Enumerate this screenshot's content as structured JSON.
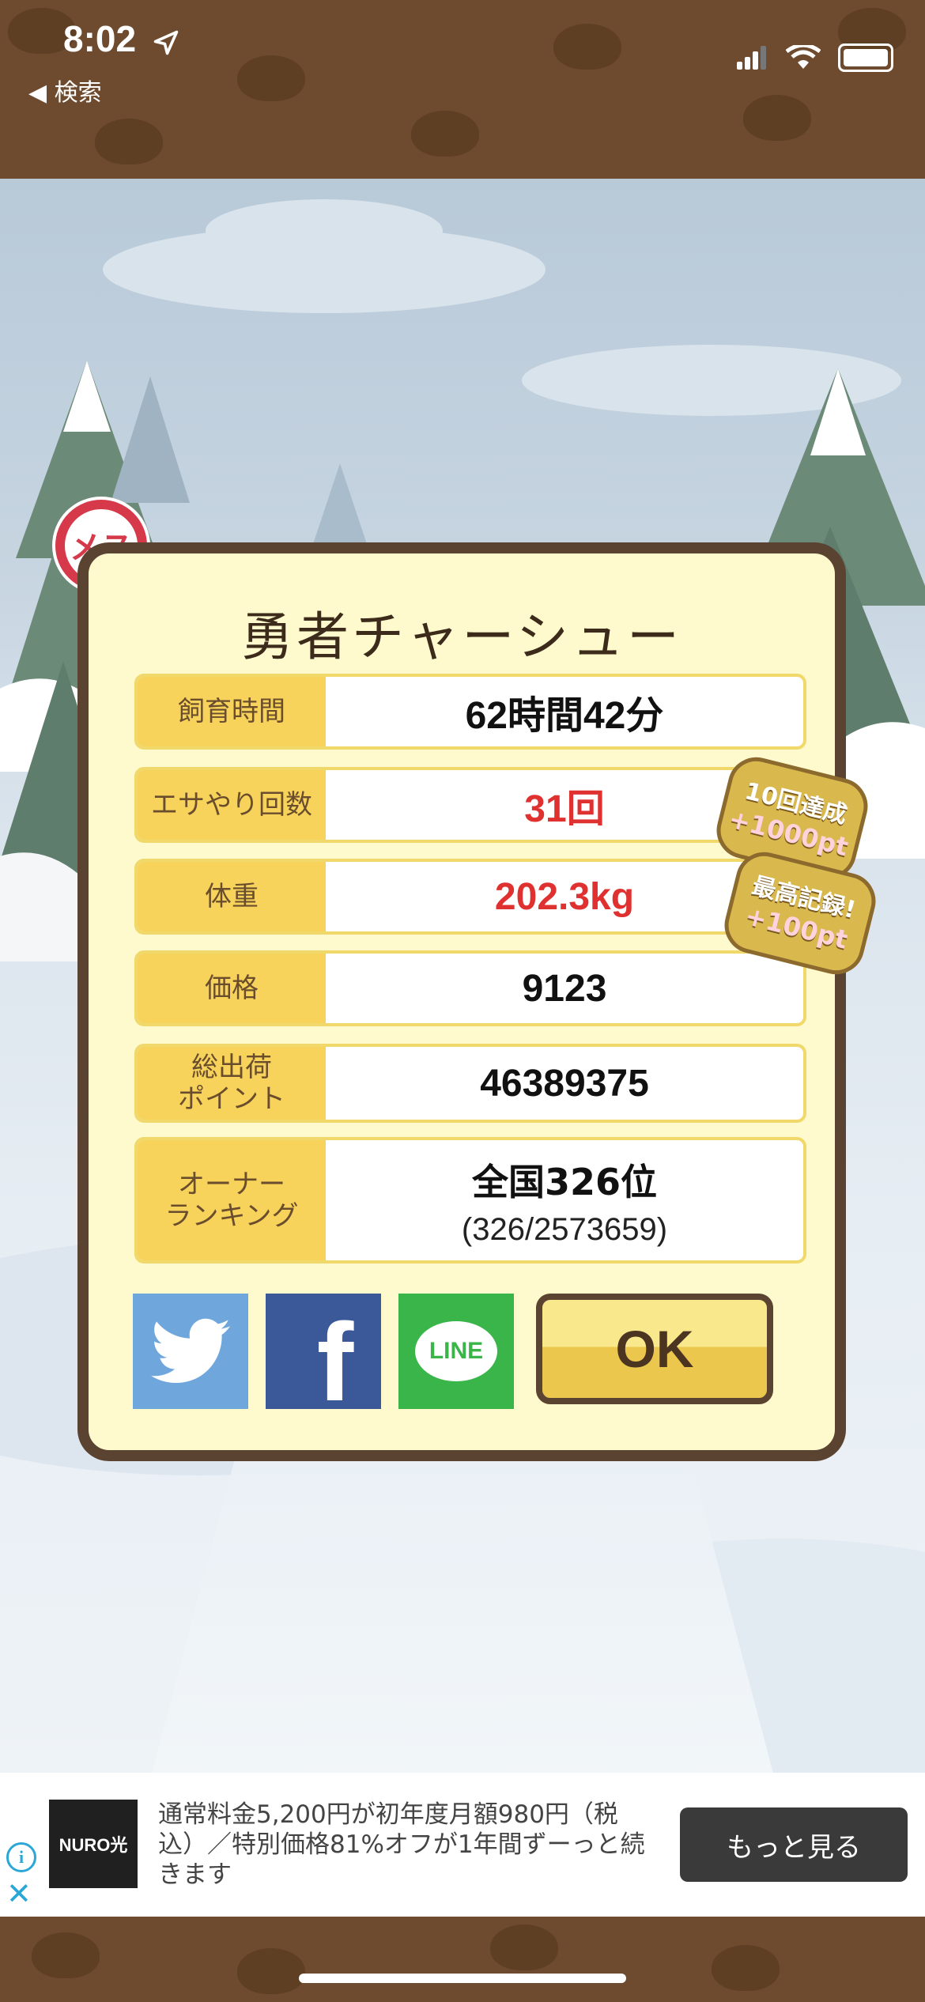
{
  "status_bar": {
    "time": "8:02",
    "back_label": "◀ 検索"
  },
  "dialog": {
    "gender_badge": "メス",
    "title": "勇者チャーシュー",
    "stats": [
      {
        "label": "飼育時間",
        "value": "62時間42分"
      },
      {
        "label": "エサやり回数",
        "value": "31回"
      },
      {
        "label": "体重",
        "value": "202.3kg"
      },
      {
        "label": "価格",
        "value": "9123"
      },
      {
        "label": "総出荷\nポイント",
        "value": "46389375"
      },
      {
        "label": "オーナー\nランキング",
        "value": "全国326位",
        "sub": "(326/2573659)"
      }
    ],
    "badges": [
      {
        "line1": "10回達成",
        "line2": "+1000pt"
      },
      {
        "line1": "最高記録!",
        "line2": "+100pt"
      }
    ],
    "ok_label": "OK",
    "share": {
      "line_label": "LINE",
      "facebook_glyph": "f"
    }
  },
  "ad": {
    "logo": "NURO光",
    "text": "通常料金5,200円が初年度月額980円（税込）／特別価格81%オフが1年間ずーっと続きます",
    "cta": "もっと見る",
    "info": "i",
    "close": "✕"
  },
  "colors": {
    "accent_red": "#e03131",
    "label_yellow": "#f7d35c",
    "frame_brown": "#5b4331",
    "panel_cream": "#fffacd"
  }
}
